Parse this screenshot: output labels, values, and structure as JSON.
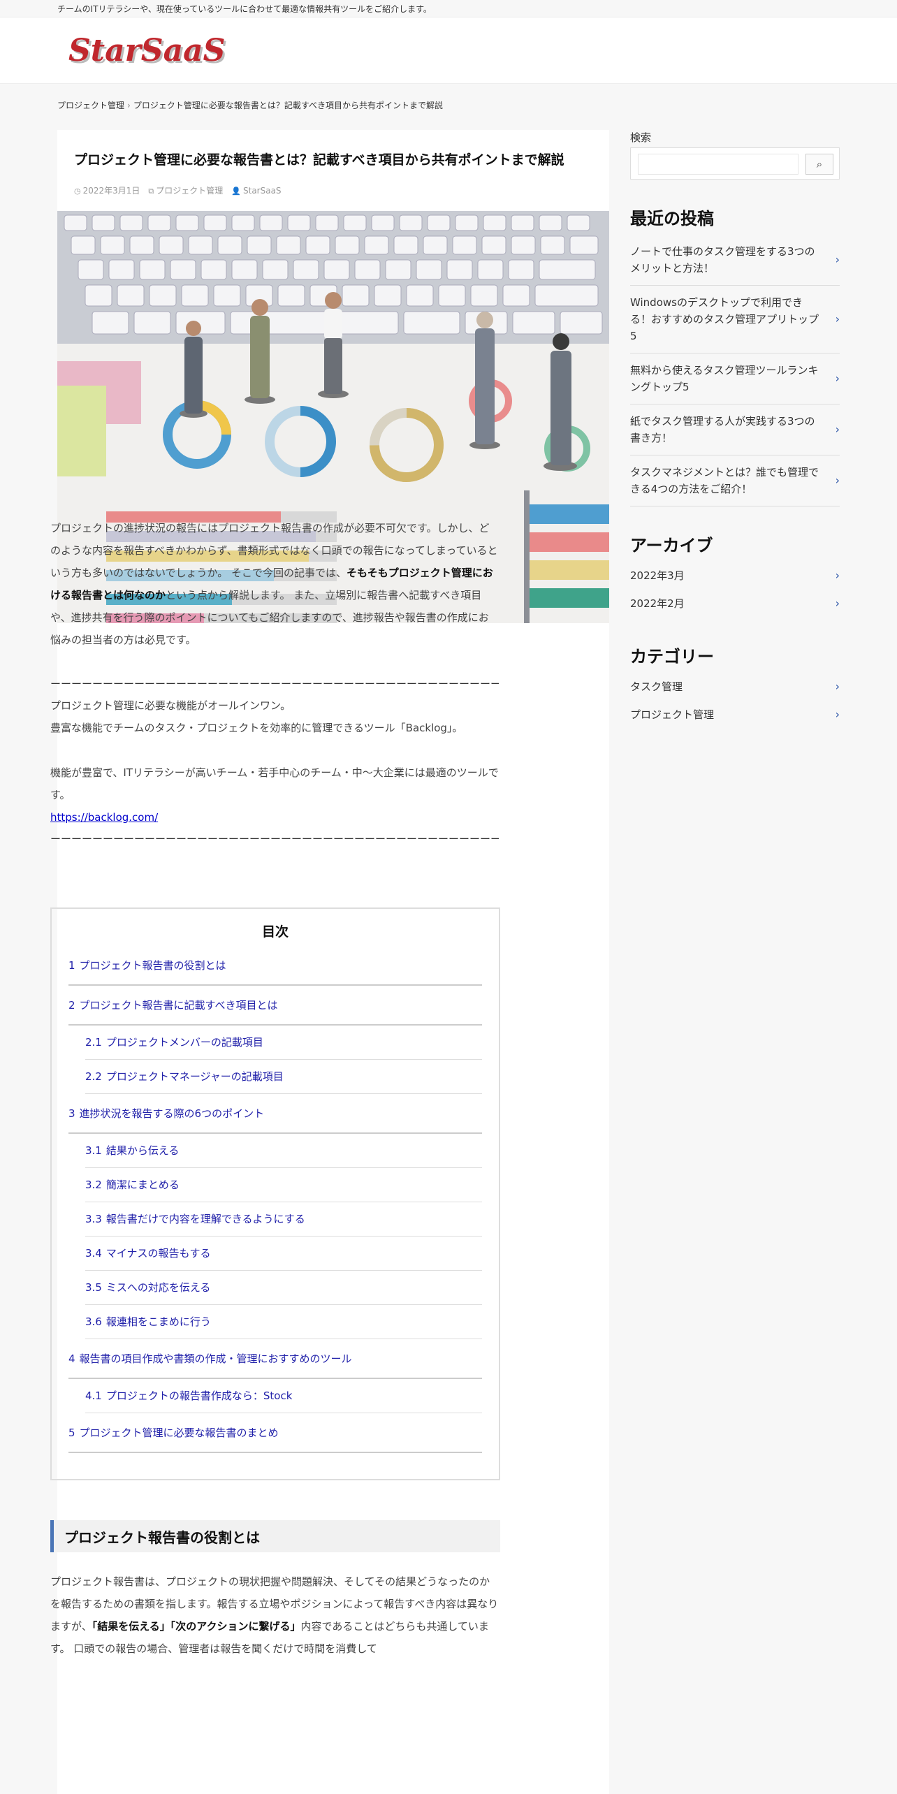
{
  "topbar": {
    "text": "チームのITリテラシーや、現在使っているツールに合わせて最適な情報共有ツールをご紹介します。"
  },
  "site": {
    "logo_text": "StarSaaS"
  },
  "breadcrumb": {
    "home": "プロジェクト管理",
    "current": "プロジェクト管理に必要な報告書とは？記載すべき項目から共有ポイントまで解説",
    "separator": "›"
  },
  "post": {
    "title": "プロジェクト管理に必要な報告書とは？記載すべき項目から共有ポイントまで解説",
    "date": "2022年3月1日",
    "category": "プロジェクト管理",
    "author": "StarSaaS"
  },
  "intro": {
    "p1_a": "プロジェクトの進捗状況の報告にはプロジェクト報告書の作成が必要不可欠です。しかし、どのような内容を報告すべきかわからず、書類形式ではなく口頭での報告になってしまっているという方も多いのではないでしょうか。 そこで今回の記事では、",
    "p1_b": "そもそもプロジェクト管理における報告書とは何なのか",
    "p1_c": "という点から解説します。 また、立場別に報告書へ記載すべき項目や、進捗共有を行う際のポイントについてもご紹介しますので、進捗報告や報告書の作成にお悩みの担当者の方は必見です。"
  },
  "ad": {
    "dashes": "ーーーーーーーーーーーーーーーーーーーーーーーーーーーーーーーーーーーーーーーーーーーーーーーー",
    "line1": "プロジェクト管理に必要な機能がオールインワン。",
    "line2": "豊富な機能でチームのタスク・プロジェクトを効率的に管理できるツール「Backlog」。",
    "line3": "機能が豊富で、ITリテラシーが高いチーム・若手中心のチーム・中〜大企業には最適のツールです。",
    "link": "https://backlog.com/"
  },
  "toc": {
    "title": "目次",
    "items": [
      {
        "num": "1",
        "label": "プロジェクト報告書の役割とは",
        "level": 1
      },
      {
        "num": "2",
        "label": "プロジェクト報告書に記載すべき項目とは",
        "level": 1
      },
      {
        "num": "2.1",
        "label": "プロジェクトメンバーの記載項目",
        "level": 2
      },
      {
        "num": "2.2",
        "label": "プロジェクトマネージャーの記載項目",
        "level": 2
      },
      {
        "num": "3",
        "label": "進捗状況を報告する際の6つのポイント",
        "level": 1
      },
      {
        "num": "3.1",
        "label": "結果から伝える",
        "level": 2
      },
      {
        "num": "3.2",
        "label": "簡潔にまとめる",
        "level": 2
      },
      {
        "num": "3.3",
        "label": "報告書だけで内容を理解できるようにする",
        "level": 2
      },
      {
        "num": "3.4",
        "label": "マイナスの報告もする",
        "level": 2
      },
      {
        "num": "3.5",
        "label": "ミスへの対応を伝える",
        "level": 2
      },
      {
        "num": "3.6",
        "label": "報連相をこまめに行う",
        "level": 2
      },
      {
        "num": "4",
        "label": "報告書の項目作成や書類の作成・管理におすすめのツール",
        "level": 1
      },
      {
        "num": "4.1",
        "label": "プロジェクトの報告書作成なら：Stock",
        "level": 2
      },
      {
        "num": "5",
        "label": "プロジェクト管理に必要な報告書のまとめ",
        "level": 1
      }
    ]
  },
  "section1": {
    "heading": "プロジェクト報告書の役割とは",
    "p_a": "プロジェクト報告書は、プロジェクトの現状把握や問題解決、そしてその結果どうなったのかを報告するための書類を指します。報告する立場やポジションによって報告すべき内容は異なりますが、",
    "p_b": "「結果を伝える」「次のアクションに繋げる」",
    "p_c": "内容であることはどちらも共通しています。 口頭での報告の場合、管理者は報告を聞くだけで時間を消費して"
  },
  "sidebar": {
    "search_label": "検索",
    "search_placeholder": "",
    "search_button_icon": "search-icon",
    "recent_title": "最近の投稿",
    "recent": [
      "ノートで仕事のタスク管理をする3つのメリットと方法！",
      "Windowsのデスクトップで利用できる！おすすめのタスク管理アプリトップ5",
      "無料から使えるタスク管理ツールランキングトップ5",
      "紙でタスク管理する人が実践する3つの書き方！",
      "タスクマネジメントとは？誰でも管理できる4つの方法をご紹介！"
    ],
    "archive_title": "アーカイブ",
    "archives": [
      "2022年3月",
      "2022年2月"
    ],
    "category_title": "カテゴリー",
    "categories": [
      "タスク管理",
      "プロジェクト管理"
    ]
  },
  "colors": {
    "accent": "#4a75b6",
    "link": "#0000cc",
    "toc_link": "#2222aa",
    "logo": "#c0272d"
  }
}
